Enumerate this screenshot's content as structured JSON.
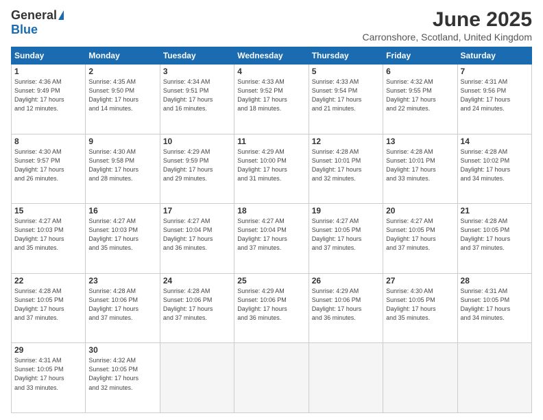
{
  "logo": {
    "general": "General",
    "blue": "Blue"
  },
  "title": {
    "month": "June 2025",
    "location": "Carronshore, Scotland, United Kingdom"
  },
  "headers": [
    "Sunday",
    "Monday",
    "Tuesday",
    "Wednesday",
    "Thursday",
    "Friday",
    "Saturday"
  ],
  "days": [
    [
      {
        "num": "",
        "info": ""
      },
      {
        "num": "2",
        "info": "Sunrise: 4:35 AM\nSunset: 9:50 PM\nDaylight: 17 hours\nand 14 minutes."
      },
      {
        "num": "3",
        "info": "Sunrise: 4:34 AM\nSunset: 9:51 PM\nDaylight: 17 hours\nand 16 minutes."
      },
      {
        "num": "4",
        "info": "Sunrise: 4:33 AM\nSunset: 9:52 PM\nDaylight: 17 hours\nand 18 minutes."
      },
      {
        "num": "5",
        "info": "Sunrise: 4:33 AM\nSunset: 9:54 PM\nDaylight: 17 hours\nand 21 minutes."
      },
      {
        "num": "6",
        "info": "Sunrise: 4:32 AM\nSunset: 9:55 PM\nDaylight: 17 hours\nand 22 minutes."
      },
      {
        "num": "7",
        "info": "Sunrise: 4:31 AM\nSunset: 9:56 PM\nDaylight: 17 hours\nand 24 minutes."
      }
    ],
    [
      {
        "num": "1",
        "info": "Sunrise: 4:36 AM\nSunset: 9:49 PM\nDaylight: 17 hours\nand 12 minutes."
      },
      {
        "num": "8",
        "info": "Sunrise: 4:30 AM\nSunset: 9:57 PM\nDaylight: 17 hours\nand 26 minutes."
      },
      {
        "num": "9",
        "info": "Sunrise: 4:30 AM\nSunset: 9:58 PM\nDaylight: 17 hours\nand 28 minutes."
      },
      {
        "num": "10",
        "info": "Sunrise: 4:29 AM\nSunset: 9:59 PM\nDaylight: 17 hours\nand 29 minutes."
      },
      {
        "num": "11",
        "info": "Sunrise: 4:29 AM\nSunset: 10:00 PM\nDaylight: 17 hours\nand 31 minutes."
      },
      {
        "num": "12",
        "info": "Sunrise: 4:28 AM\nSunset: 10:01 PM\nDaylight: 17 hours\nand 32 minutes."
      },
      {
        "num": "13",
        "info": "Sunrise: 4:28 AM\nSunset: 10:01 PM\nDaylight: 17 hours\nand 33 minutes."
      }
    ],
    [
      {
        "num": "14",
        "info": "Sunrise: 4:28 AM\nSunset: 10:02 PM\nDaylight: 17 hours\nand 34 minutes."
      },
      {
        "num": "15",
        "info": "Sunrise: 4:27 AM\nSunset: 10:03 PM\nDaylight: 17 hours\nand 35 minutes."
      },
      {
        "num": "16",
        "info": "Sunrise: 4:27 AM\nSunset: 10:03 PM\nDaylight: 17 hours\nand 35 minutes."
      },
      {
        "num": "17",
        "info": "Sunrise: 4:27 AM\nSunset: 10:04 PM\nDaylight: 17 hours\nand 36 minutes."
      },
      {
        "num": "18",
        "info": "Sunrise: 4:27 AM\nSunset: 10:04 PM\nDaylight: 17 hours\nand 37 minutes."
      },
      {
        "num": "19",
        "info": "Sunrise: 4:27 AM\nSunset: 10:05 PM\nDaylight: 17 hours\nand 37 minutes."
      },
      {
        "num": "20",
        "info": "Sunrise: 4:27 AM\nSunset: 10:05 PM\nDaylight: 17 hours\nand 37 minutes."
      }
    ],
    [
      {
        "num": "21",
        "info": "Sunrise: 4:28 AM\nSunset: 10:05 PM\nDaylight: 17 hours\nand 37 minutes."
      },
      {
        "num": "22",
        "info": "Sunrise: 4:28 AM\nSunset: 10:05 PM\nDaylight: 17 hours\nand 37 minutes."
      },
      {
        "num": "23",
        "info": "Sunrise: 4:28 AM\nSunset: 10:06 PM\nDaylight: 17 hours\nand 37 minutes."
      },
      {
        "num": "24",
        "info": "Sunrise: 4:28 AM\nSunset: 10:06 PM\nDaylight: 17 hours\nand 37 minutes."
      },
      {
        "num": "25",
        "info": "Sunrise: 4:29 AM\nSunset: 10:06 PM\nDaylight: 17 hours\nand 36 minutes."
      },
      {
        "num": "26",
        "info": "Sunrise: 4:29 AM\nSunset: 10:06 PM\nDaylight: 17 hours\nand 36 minutes."
      },
      {
        "num": "27",
        "info": "Sunrise: 4:30 AM\nSunset: 10:05 PM\nDaylight: 17 hours\nand 35 minutes."
      }
    ],
    [
      {
        "num": "28",
        "info": "Sunrise: 4:31 AM\nSunset: 10:05 PM\nDaylight: 17 hours\nand 34 minutes."
      },
      {
        "num": "29",
        "info": "Sunrise: 4:31 AM\nSunset: 10:05 PM\nDaylight: 17 hours\nand 33 minutes."
      },
      {
        "num": "30",
        "info": "Sunrise: 4:32 AM\nSunset: 10:05 PM\nDaylight: 17 hours\nand 32 minutes."
      },
      {
        "num": "",
        "info": ""
      },
      {
        "num": "",
        "info": ""
      },
      {
        "num": "",
        "info": ""
      },
      {
        "num": "",
        "info": ""
      }
    ]
  ]
}
